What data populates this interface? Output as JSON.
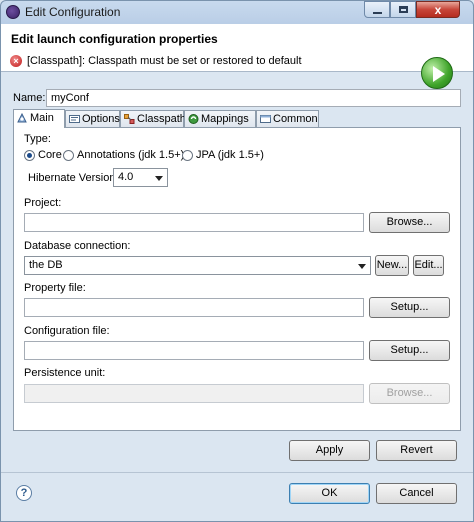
{
  "window": {
    "title": "Edit Configuration",
    "close_label": "x"
  },
  "banner": {
    "title": "Edit launch configuration properties",
    "message": "[Classpath]: Classpath must be set or restored to default"
  },
  "name": {
    "label": "Name:",
    "value": "myConf"
  },
  "tabs": [
    {
      "label": "Main",
      "icon": "main-tab-icon"
    },
    {
      "label": "Options",
      "icon": "options-tab-icon"
    },
    {
      "label": "Classpath",
      "icon": "classpath-tab-icon"
    },
    {
      "label": "Mappings",
      "icon": "mappings-tab-icon"
    },
    {
      "label": "Common",
      "icon": "common-tab-icon"
    }
  ],
  "main": {
    "type_label": "Type:",
    "types": [
      {
        "label": "Core",
        "selected": true
      },
      {
        "label": "Annotations (jdk 1.5+)",
        "selected": false
      },
      {
        "label": "JPA (jdk 1.5+)",
        "selected": false
      }
    ],
    "hibernate_version_label": "Hibernate Version:",
    "hibernate_version": "4.0",
    "project_label": "Project:",
    "project_value": "",
    "browse_label": "Browse...",
    "db_label": "Database connection:",
    "db_value": "the DB",
    "new_label": "New...",
    "edit_label": "Edit...",
    "property_label": "Property file:",
    "property_value": "",
    "setup_label": "Setup...",
    "config_label": "Configuration file:",
    "config_value": "",
    "config_setup_label": "Setup...",
    "persistence_label": "Persistence unit:",
    "persistence_value": "",
    "persistence_browse_label": "Browse..."
  },
  "actions": {
    "apply": "Apply",
    "revert": "Revert",
    "ok": "OK",
    "cancel": "Cancel",
    "help": "?"
  }
}
